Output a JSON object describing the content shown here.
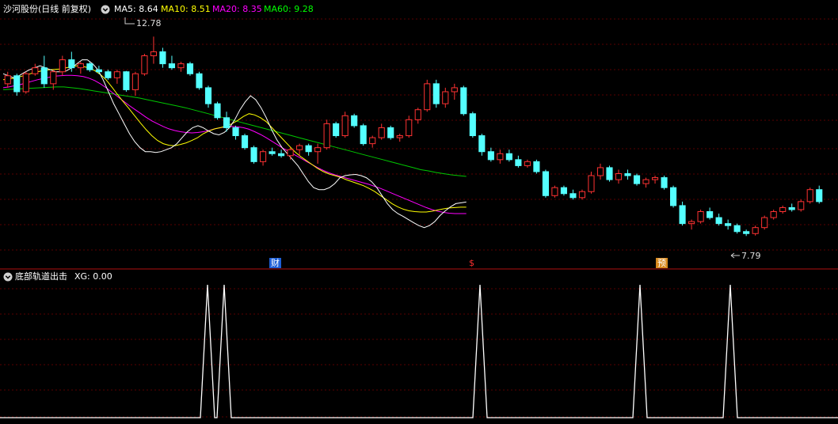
{
  "main_panel": {
    "title": "沙河股份(日线 前复权)",
    "toggle_icon": "chevron-down-icon",
    "ma_labels": [
      {
        "text": "MA5: 8.64",
        "color": "#ffffff"
      },
      {
        "text": "MA10: 8.51",
        "color": "#ffff00"
      },
      {
        "text": "MA20: 8.35",
        "color": "#ff00ff"
      },
      {
        "text": "MA60: 9.28",
        "color": "#00ff00"
      }
    ],
    "high_label": "12.78",
    "low_label": "7.79",
    "event_markers": [
      {
        "text": "财",
        "color": "#1e5fd6",
        "candle": 48
      },
      {
        "text": "$",
        "color": "#ff3030",
        "candle": 84
      },
      {
        "text": "预",
        "color": "#d88a1e",
        "candle": 118
      }
    ]
  },
  "indicator_panel": {
    "title": "底部轨道出击",
    "value_text": "XG: 0.00",
    "toggle_icon": "chevron-down-icon"
  },
  "chart_data": {
    "type": "candlestick",
    "ylim": [
      7.4,
      13.3
    ],
    "up_color": "#ff3232",
    "down_color": "#54ffff",
    "candles": [
      [
        11.6,
        11.9,
        11.5,
        11.8
      ],
      [
        11.8,
        11.85,
        11.3,
        11.4
      ],
      [
        11.4,
        11.9,
        11.35,
        11.85
      ],
      [
        11.85,
        12.1,
        11.8,
        12.0
      ],
      [
        12.0,
        12.3,
        11.5,
        11.6
      ],
      [
        11.6,
        11.95,
        11.45,
        11.9
      ],
      [
        11.9,
        12.3,
        11.8,
        12.2
      ],
      [
        12.2,
        12.4,
        11.9,
        12.0
      ],
      [
        12.0,
        12.15,
        11.85,
        12.1
      ],
      [
        12.1,
        12.15,
        11.9,
        11.95
      ],
      [
        11.95,
        12.05,
        11.85,
        11.9
      ],
      [
        11.9,
        11.95,
        11.7,
        11.75
      ],
      [
        11.75,
        11.95,
        11.6,
        11.9
      ],
      [
        11.9,
        11.92,
        11.4,
        11.45
      ],
      [
        11.45,
        11.9,
        11.3,
        11.85
      ],
      [
        11.85,
        12.35,
        11.8,
        12.3
      ],
      [
        12.3,
        12.78,
        12.1,
        12.4
      ],
      [
        12.4,
        12.5,
        12.0,
        12.1
      ],
      [
        12.1,
        12.3,
        11.95,
        12.0
      ],
      [
        12.0,
        12.15,
        11.9,
        12.1
      ],
      [
        12.1,
        12.15,
        11.8,
        11.85
      ],
      [
        11.85,
        11.9,
        11.45,
        11.5
      ],
      [
        11.5,
        11.55,
        11.0,
        11.1
      ],
      [
        11.1,
        11.15,
        10.7,
        10.75
      ],
      [
        10.75,
        10.9,
        10.4,
        10.5
      ],
      [
        10.5,
        10.55,
        10.2,
        10.3
      ],
      [
        10.3,
        10.35,
        9.95,
        10.0
      ],
      [
        10.0,
        10.05,
        9.6,
        9.65
      ],
      [
        9.65,
        9.95,
        9.55,
        9.9
      ],
      [
        9.9,
        10.0,
        9.8,
        9.85
      ],
      [
        9.85,
        9.95,
        9.75,
        9.8
      ],
      [
        9.8,
        10.0,
        9.7,
        9.95
      ],
      [
        9.95,
        10.1,
        9.8,
        10.05
      ],
      [
        10.05,
        10.1,
        9.8,
        9.9
      ],
      [
        9.9,
        10.1,
        9.6,
        10.0
      ],
      [
        10.0,
        10.7,
        9.95,
        10.6
      ],
      [
        10.6,
        10.65,
        10.25,
        10.3
      ],
      [
        10.3,
        10.9,
        10.25,
        10.8
      ],
      [
        10.8,
        10.85,
        10.5,
        10.55
      ],
      [
        10.55,
        10.6,
        10.05,
        10.1
      ],
      [
        10.1,
        10.3,
        10.0,
        10.25
      ],
      [
        10.25,
        10.6,
        10.2,
        10.5
      ],
      [
        10.5,
        10.55,
        10.2,
        10.25
      ],
      [
        10.25,
        10.35,
        10.15,
        10.3
      ],
      [
        10.3,
        10.8,
        10.25,
        10.7
      ],
      [
        10.7,
        11.0,
        10.6,
        10.95
      ],
      [
        10.95,
        11.7,
        10.9,
        11.6
      ],
      [
        11.6,
        11.7,
        11.0,
        11.1
      ],
      [
        11.1,
        11.5,
        11.0,
        11.4
      ],
      [
        11.4,
        11.6,
        11.2,
        11.5
      ],
      [
        11.5,
        11.55,
        10.8,
        10.85
      ],
      [
        10.85,
        10.9,
        10.25,
        10.3
      ],
      [
        10.3,
        10.35,
        9.8,
        9.9
      ],
      [
        9.9,
        10.0,
        9.65,
        9.7
      ],
      [
        9.7,
        9.95,
        9.6,
        9.85
      ],
      [
        9.85,
        9.95,
        9.65,
        9.7
      ],
      [
        9.7,
        9.8,
        9.5,
        9.55
      ],
      [
        9.55,
        9.7,
        9.5,
        9.65
      ],
      [
        9.65,
        9.7,
        9.35,
        9.4
      ],
      [
        9.4,
        9.45,
        8.75,
        8.8
      ],
      [
        8.8,
        9.05,
        8.75,
        9.0
      ],
      [
        9.0,
        9.05,
        8.8,
        8.85
      ],
      [
        8.85,
        8.95,
        8.7,
        8.75
      ],
      [
        8.75,
        8.95,
        8.7,
        8.9
      ],
      [
        8.9,
        9.4,
        8.85,
        9.3
      ],
      [
        9.3,
        9.6,
        9.2,
        9.5
      ],
      [
        9.5,
        9.55,
        9.15,
        9.2
      ],
      [
        9.2,
        9.45,
        9.1,
        9.35
      ],
      [
        9.35,
        9.45,
        9.2,
        9.3
      ],
      [
        9.3,
        9.35,
        9.05,
        9.1
      ],
      [
        9.1,
        9.25,
        9.0,
        9.2
      ],
      [
        9.2,
        9.3,
        9.1,
        9.25
      ],
      [
        9.25,
        9.3,
        8.95,
        9.0
      ],
      [
        9.0,
        9.05,
        8.5,
        8.55
      ],
      [
        8.55,
        8.65,
        8.05,
        8.1
      ],
      [
        8.1,
        8.2,
        7.95,
        8.15
      ],
      [
        8.15,
        8.45,
        8.1,
        8.4
      ],
      [
        8.4,
        8.5,
        8.2,
        8.25
      ],
      [
        8.25,
        8.35,
        8.05,
        8.1
      ],
      [
        8.1,
        8.2,
        7.95,
        8.05
      ],
      [
        8.05,
        8.1,
        7.85,
        7.9
      ],
      [
        7.9,
        7.95,
        7.79,
        7.85
      ],
      [
        7.85,
        8.05,
        7.8,
        8.0
      ],
      [
        8.0,
        8.3,
        7.95,
        8.25
      ],
      [
        8.25,
        8.45,
        8.2,
        8.4
      ],
      [
        8.4,
        8.55,
        8.35,
        8.5
      ],
      [
        8.5,
        8.6,
        8.4,
        8.45
      ],
      [
        8.45,
        8.7,
        8.4,
        8.65
      ],
      [
        8.65,
        9.0,
        8.6,
        8.95
      ],
      [
        8.95,
        9.05,
        8.6,
        8.65
      ]
    ],
    "ma5": [
      11.85,
      11.8,
      11.75,
      11.8,
      11.88,
      11.95,
      12.0,
      12.05,
      12.0,
      11.95,
      11.9,
      11.9,
      11.92,
      12.0,
      12.1,
      12.2,
      12.2,
      12.1,
      11.95,
      11.7,
      11.4,
      11.1,
      10.85,
      10.6,
      10.35,
      10.15,
      10.0,
      9.9,
      9.9,
      9.88,
      9.9,
      9.95,
      10.0,
      10.1,
      10.25,
      10.4,
      10.5,
      10.55,
      10.5,
      10.42,
      10.35,
      10.32,
      10.38,
      10.5,
      10.7,
      10.95,
      11.15,
      11.3,
      11.2,
      11.0,
      10.75,
      10.45,
      10.2,
      10.0,
      9.85,
      9.7,
      9.55,
      9.35,
      9.15,
      9.0,
      8.95,
      8.95,
      9.0,
      9.1,
      9.25,
      9.3,
      9.32,
      9.33,
      9.3,
      9.25,
      9.15,
      9.0,
      8.8,
      8.6,
      8.45,
      8.35,
      8.28,
      8.2,
      8.12,
      8.05,
      8.0,
      8.05,
      8.15,
      8.3,
      8.42,
      8.52,
      8.6,
      8.62,
      8.64
    ],
    "ma10": [
      11.7,
      11.72,
      11.74,
      11.78,
      11.82,
      11.86,
      11.9,
      11.93,
      11.95,
      11.96,
      11.97,
      12.0,
      12.03,
      12.05,
      12.03,
      12.0,
      11.93,
      11.83,
      11.7,
      11.52,
      11.33,
      11.15,
      10.98,
      10.8,
      10.62,
      10.45,
      10.3,
      10.18,
      10.1,
      10.06,
      10.05,
      10.08,
      10.12,
      10.18,
      10.25,
      10.35,
      10.42,
      10.47,
      10.5,
      10.54,
      10.6,
      10.68,
      10.78,
      10.85,
      10.82,
      10.75,
      10.65,
      10.5,
      10.35,
      10.2,
      10.05,
      9.9,
      9.78,
      9.68,
      9.58,
      9.48,
      9.4,
      9.34,
      9.3,
      9.26,
      9.2,
      9.15,
      9.1,
      9.05,
      8.98,
      8.9,
      8.8,
      8.7,
      8.6,
      8.52,
      8.46,
      8.42,
      8.4,
      8.39,
      8.39,
      8.41,
      8.44,
      8.47,
      8.49,
      8.5,
      8.51,
      8.51
    ],
    "ma20": [
      11.5,
      11.52,
      11.55,
      11.58,
      11.62,
      11.66,
      11.7,
      11.73,
      11.76,
      11.79,
      11.8,
      11.81,
      11.81,
      11.8,
      11.78,
      11.74,
      11.68,
      11.6,
      11.5,
      11.39,
      11.28,
      11.17,
      11.06,
      10.96,
      10.86,
      10.76,
      10.67,
      10.6,
      10.53,
      10.47,
      10.43,
      10.4,
      10.38,
      10.37,
      10.38,
      10.4,
      10.43,
      10.47,
      10.5,
      10.52,
      10.53,
      10.52,
      10.5,
      10.46,
      10.4,
      10.33,
      10.25,
      10.16,
      10.07,
      9.98,
      9.9,
      9.82,
      9.74,
      9.66,
      9.58,
      9.5,
      9.43,
      9.37,
      9.32,
      9.28,
      9.24,
      9.2,
      9.16,
      9.12,
      9.08,
      9.03,
      8.98,
      8.92,
      8.86,
      8.8,
      8.74,
      8.68,
      8.62,
      8.56,
      8.5,
      8.45,
      8.41,
      8.38,
      8.36,
      8.35,
      8.35,
      8.35
    ],
    "ma60": [
      11.45,
      11.46,
      11.47,
      11.48,
      11.49,
      11.5,
      11.51,
      11.52,
      11.52,
      11.5,
      11.48,
      11.45,
      11.42,
      11.39,
      11.36,
      11.33,
      11.3,
      11.27,
      11.24,
      11.2,
      11.16,
      11.12,
      11.08,
      11.04,
      11.0,
      10.95,
      10.9,
      10.85,
      10.8,
      10.75,
      10.7,
      10.65,
      10.6,
      10.55,
      10.5,
      10.45,
      10.4,
      10.35,
      10.3,
      10.25,
      10.2,
      10.15,
      10.1,
      10.05,
      10.0,
      9.95,
      9.9,
      9.85,
      9.8,
      9.75,
      9.7,
      9.65,
      9.6,
      9.55,
      9.5,
      9.45,
      9.42,
      9.38,
      9.35,
      9.32,
      9.3,
      9.28
    ],
    "xg_signals": [
      {
        "candle": 38,
        "value": 1
      },
      {
        "candle": 41,
        "value": 1
      },
      {
        "candle": 98,
        "value": 1
      },
      {
        "candle": 133,
        "value": 1
      },
      {
        "candle": 151,
        "value": 1
      }
    ]
  }
}
